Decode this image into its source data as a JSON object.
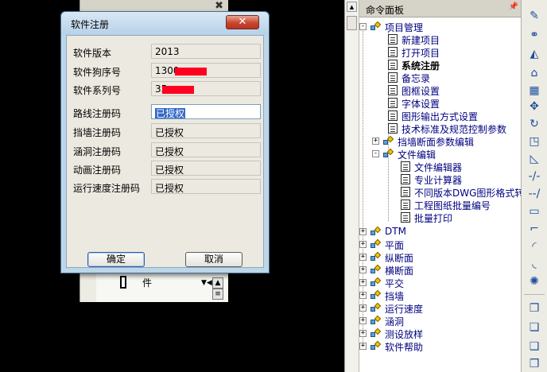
{
  "background_panel": {
    "strip_label": "件",
    "icons": [
      "document-icon",
      "dropdown-arrow-icon",
      "scroll-up-icon",
      "list-icon"
    ]
  },
  "dialog": {
    "title": "软件注册",
    "close_label": "✕",
    "fields": [
      {
        "label": "软件版本",
        "value": "2013",
        "redacted": false
      },
      {
        "label": "软件狗序号",
        "value": "1300",
        "redacted": true
      },
      {
        "label": "软件系列号",
        "value": "35",
        "redacted": true
      },
      {
        "label": "路线注册码",
        "value": "已授权",
        "active": true
      },
      {
        "label": "挡墙注册码",
        "value": "已授权"
      },
      {
        "label": "涵洞注册码",
        "value": "已授权"
      },
      {
        "label": "动画注册码",
        "value": "已授权"
      },
      {
        "label": "运行速度注册码",
        "value": "已授权"
      }
    ],
    "ok_label": "确定",
    "cancel_label": "取消"
  },
  "command_panel": {
    "title": "命令面板",
    "pin_label": "📌",
    "expanded_group": "项目管理",
    "children": [
      {
        "label": "新建项目",
        "bold": false
      },
      {
        "label": "打开项目",
        "bold": false
      },
      {
        "label": "系统注册",
        "bold": true
      },
      {
        "label": "备忘录",
        "bold": false
      },
      {
        "label": "图框设置",
        "bold": false
      },
      {
        "label": "字体设置",
        "bold": false
      },
      {
        "label": "图形输出方式设置",
        "bold": false
      },
      {
        "label": "技术标准及规范控制参数",
        "bold": false
      }
    ],
    "subgroups": [
      {
        "label": "挡墙断面参数编辑",
        "expander": "+"
      },
      {
        "label": "文件编辑",
        "expander": "-"
      }
    ],
    "sub_children": [
      {
        "label": "文件编辑器"
      },
      {
        "label": "专业计算器"
      },
      {
        "label": "不同版本DWG图形格式转换"
      },
      {
        "label": "工程图纸批量编号"
      },
      {
        "label": "批量打印"
      }
    ],
    "groups": [
      "DTM",
      "平面",
      "纵断面",
      "横断面",
      "平交",
      "挡墙",
      "运行速度",
      "涵洞",
      "测设放样",
      "软件帮助"
    ]
  },
  "toolbar": {
    "icons": [
      "pencil-icon",
      "link-icon",
      "mirror-icon",
      "offset-icon",
      "array-icon",
      "move-icon",
      "rotate-icon",
      "scale-icon",
      "stretch-icon",
      "trim-icon",
      "extend-icon",
      "break-icon",
      "chamfer-icon",
      "fillet-icon",
      "explode-icon",
      "copy-icon",
      "layer-icon",
      "group-icon",
      "block-icon",
      "block2-icon"
    ]
  }
}
